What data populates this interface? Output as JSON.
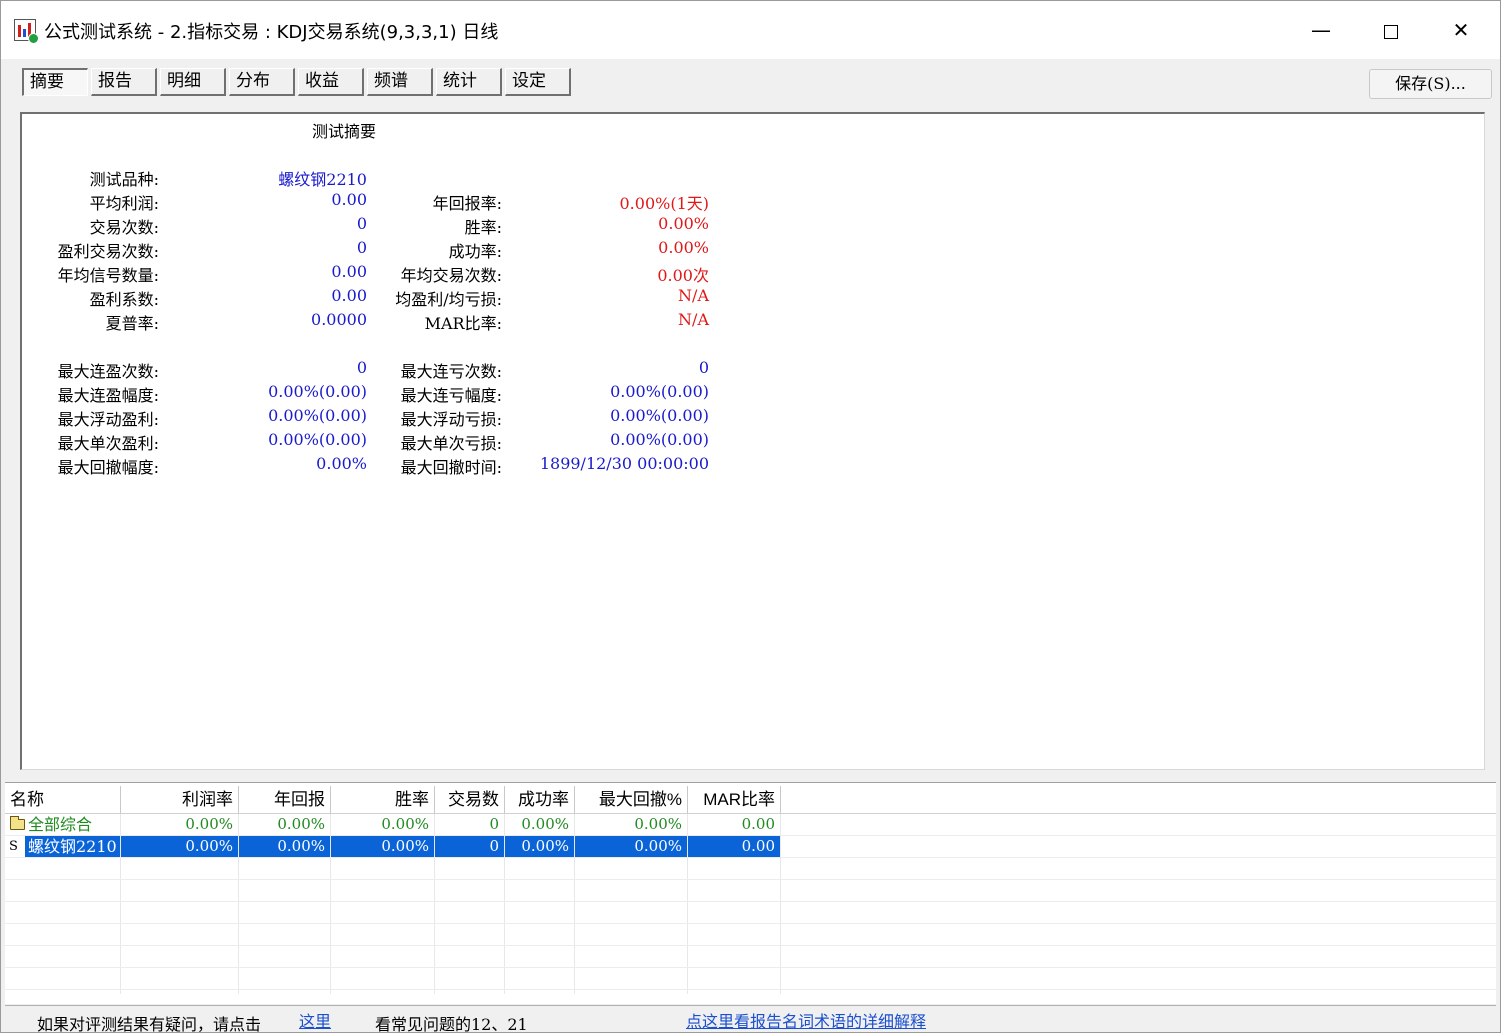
{
  "window": {
    "title": "公式测试系统 - 2.指标交易 : KDJ交易系统(9,3,3,1) 日线",
    "minimize": "—",
    "close": "✕"
  },
  "tabs": [
    {
      "label": "摘要",
      "active": true
    },
    {
      "label": "报告"
    },
    {
      "label": "明细"
    },
    {
      "label": "分布"
    },
    {
      "label": "收益"
    },
    {
      "label": "频谱"
    },
    {
      "label": "统计"
    },
    {
      "label": "设定"
    }
  ],
  "save_button": "保存(S)...",
  "report": {
    "title": "测试摘要",
    "left": [
      {
        "label": "测试品种:",
        "value": "螺纹钢2210"
      },
      {
        "label": "平均利润:",
        "value": "0.00"
      },
      {
        "label": "交易次数:",
        "value": "0"
      },
      {
        "label": "盈利交易次数:",
        "value": "0"
      },
      {
        "label": "年均信号数量:",
        "value": "0.00"
      },
      {
        "label": "盈利系数:",
        "value": "0.00"
      },
      {
        "label": "夏普率:",
        "value": "0.0000"
      }
    ],
    "right": [
      {
        "label": "年回报率:",
        "value": "0.00%(1天)"
      },
      {
        "label": "胜率:",
        "value": "0.00%"
      },
      {
        "label": "成功率:",
        "value": "0.00%"
      },
      {
        "label": "年均交易次数:",
        "value": "0.00次"
      },
      {
        "label": "均盈利/均亏损:",
        "value": "N/A"
      },
      {
        "label": "MAR比率:",
        "value": "N/A"
      }
    ],
    "left2": [
      {
        "label": "最大连盈次数:",
        "value": "0"
      },
      {
        "label": "最大连盈幅度:",
        "value": "0.00%(0.00)"
      },
      {
        "label": "最大浮动盈利:",
        "value": "0.00%(0.00)"
      },
      {
        "label": "最大单次盈利:",
        "value": "0.00%(0.00)"
      },
      {
        "label": "最大回撤幅度:",
        "value": "0.00%"
      }
    ],
    "right2": [
      {
        "label": "最大连亏次数:",
        "value": "0"
      },
      {
        "label": "最大连亏幅度:",
        "value": "0.00%(0.00)"
      },
      {
        "label": "最大浮动亏损:",
        "value": "0.00%(0.00)"
      },
      {
        "label": "最大单次亏损:",
        "value": "0.00%(0.00)"
      },
      {
        "label": "最大回撤时间:",
        "value": "1899/12/30 00:00:00"
      }
    ]
  },
  "grid": {
    "columns": [
      "名称",
      "利润率",
      "年回报",
      "胜率",
      "交易数",
      "成功率",
      "最大回撤%",
      "MAR比率"
    ],
    "rows": [
      {
        "marker": "",
        "cells": [
          "全部综合",
          "0.00%",
          "0.00%",
          "0.00%",
          "0",
          "0.00%",
          "0.00%",
          "0.00"
        ]
      },
      {
        "marker": "S",
        "cells": [
          "螺纹钢2210",
          "0.00%",
          "0.00%",
          "0.00%",
          "0",
          "0.00%",
          "0.00%",
          "0.00"
        ]
      }
    ]
  },
  "status": {
    "text1": "如果对评测结果有疑问，请点击",
    "link1": "这里",
    "text2": "看常见问题的12、21",
    "link2": "点这里看报告名词术语的详细解释"
  }
}
